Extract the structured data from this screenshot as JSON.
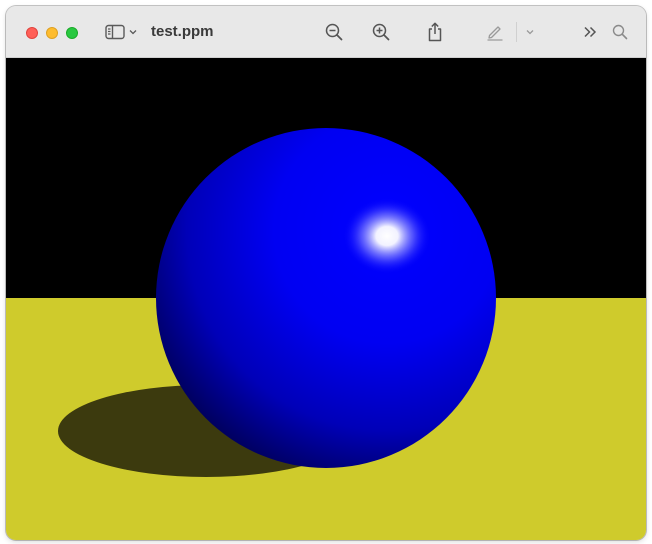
{
  "window": {
    "title": "test.ppm",
    "traffic_lights": [
      "close",
      "minimize",
      "zoom"
    ]
  },
  "toolbar": {
    "sidebar_toggle": {
      "icon": "sidebar-icon",
      "has_menu": true
    },
    "zoom_out": {
      "icon": "zoom-out-icon"
    },
    "zoom_in": {
      "icon": "zoom-in-icon"
    },
    "share": {
      "icon": "share-icon"
    },
    "markup": {
      "icon": "pencil-icon",
      "has_menu": true
    },
    "overflow": {
      "icon": "chevron-double-right-icon"
    },
    "search": {
      "icon": "search-icon"
    }
  },
  "image": {
    "description_colors": {
      "sky": "#000000",
      "floor": "#cfcb2c",
      "shadow": "#3c3a0e",
      "sphere": "#0000ff",
      "highlight": "#ffffff"
    }
  }
}
